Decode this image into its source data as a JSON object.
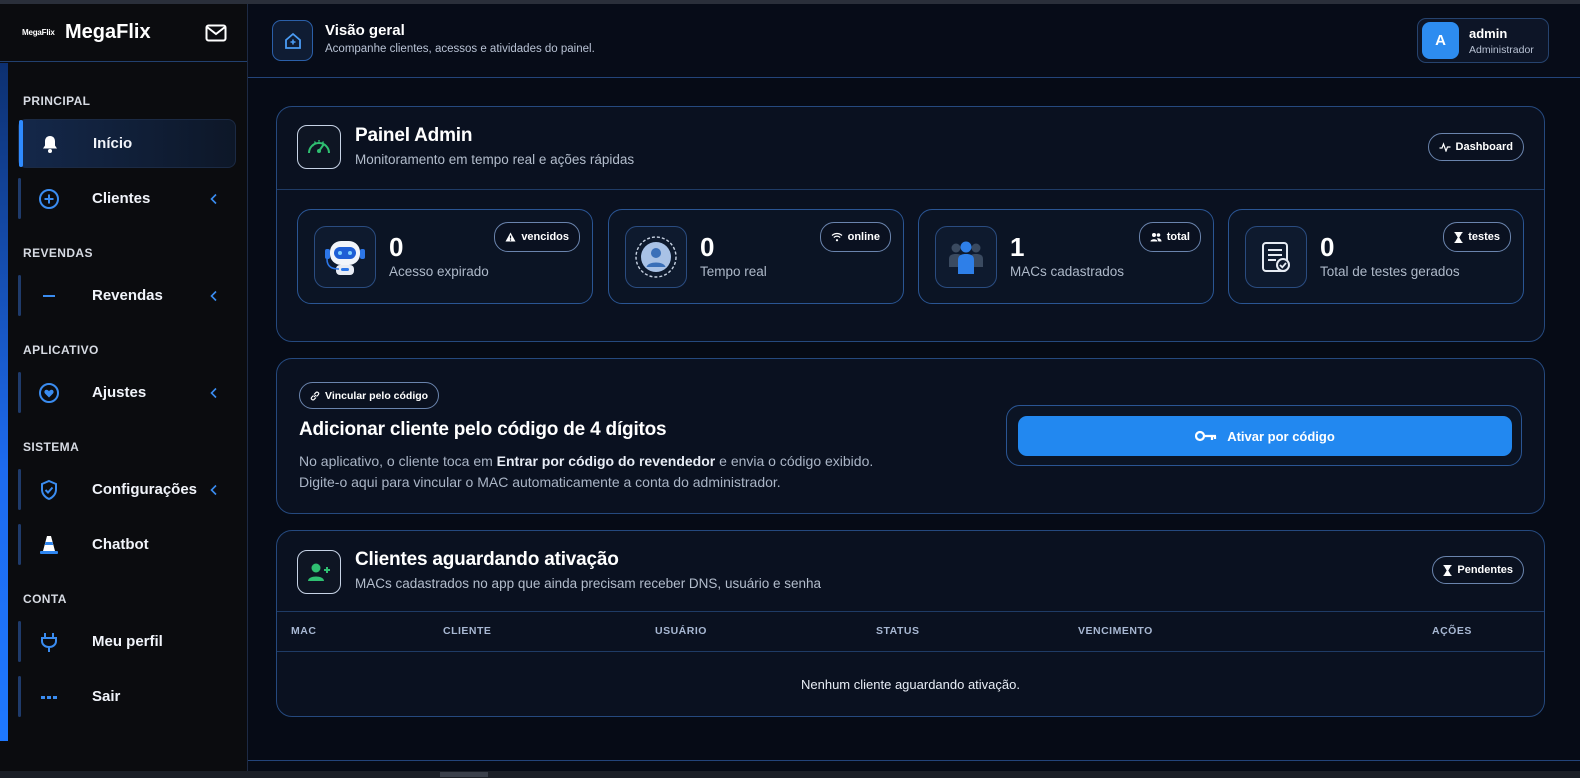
{
  "sidebar": {
    "logo_small": "MegaFlix",
    "brand": "MegaFlix",
    "sections": {
      "principal": "PRINCIPAL",
      "revendas": "REVENDAS",
      "aplicativo": "APLICATIVO",
      "sistema": "SISTEMA",
      "conta": "CONTA"
    },
    "items": {
      "inicio": "Início",
      "clientes": "Clientes",
      "revendas": "Revendas",
      "ajustes": "Ajustes",
      "configuracoes": "Configurações",
      "chatbot": "Chatbot",
      "perfil": "Meu perfil",
      "sair": "Sair"
    }
  },
  "header": {
    "title": "Visão geral",
    "subtitle": "Acompanhe clientes, acessos e atividades do painel.",
    "user": {
      "initial": "A",
      "name": "admin",
      "role": "Administrador"
    }
  },
  "admin_panel": {
    "title": "Painel Admin",
    "subtitle": "Monitoramento em tempo real e ações rápidas",
    "badge": "Dashboard",
    "stats": [
      {
        "value": "0",
        "label": "Acesso expirado",
        "badge": "vencidos"
      },
      {
        "value": "0",
        "label": "Tempo real",
        "badge": "online"
      },
      {
        "value": "1",
        "label": "MACs cadastrados",
        "badge": "total"
      },
      {
        "value": "0",
        "label": "Total de testes gerados",
        "badge": "testes"
      }
    ]
  },
  "link_code": {
    "badge": "Vincular pelo código",
    "title": "Adicionar cliente pelo código de 4 dígitos",
    "text_1": "No aplicativo, o cliente toca em ",
    "text_bold": "Entrar por código do revendedor",
    "text_2": " e envia o código exibido.",
    "text_3": "Digite-o aqui para vincular o MAC automaticamente a conta do administrador.",
    "button": "Ativar por código"
  },
  "pending": {
    "title": "Clientes aguardando ativação",
    "subtitle": "MACs cadastrados no app que ainda precisam receber DNS, usuário e senha",
    "badge": "Pendentes",
    "columns": [
      "MAC",
      "CLIENTE",
      "USUÁRIO",
      "STATUS",
      "VENCIMENTO",
      "AÇÕES"
    ],
    "empty": "Nenhum cliente aguardando ativação."
  },
  "colors": {
    "accent": "#2288f0",
    "border": "#25497e",
    "background": "#060b16"
  }
}
